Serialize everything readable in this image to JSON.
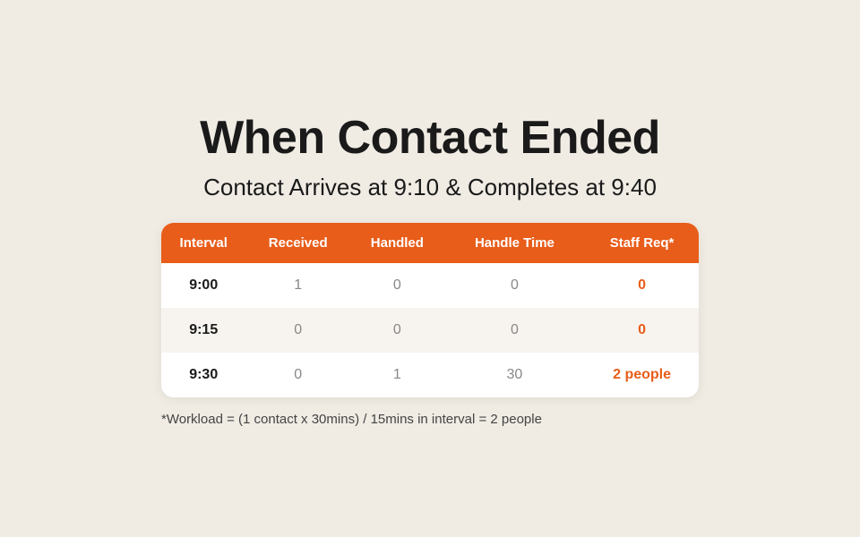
{
  "page": {
    "background_color": "#f0ece4",
    "title": "When Contact Ended",
    "subtitle": "Contact Arrives at 9:10 & Completes at 9:40",
    "footnote": "*Workload = (1 contact x 30mins) / 15mins in interval = 2 people"
  },
  "table": {
    "headers": [
      "Interval",
      "Received",
      "Handled",
      "Handle Time",
      "Staff Req*"
    ],
    "rows": [
      {
        "interval": "9:00",
        "received": "1",
        "handled": "0",
        "handle_time": "0",
        "staff_req": "0",
        "staff_req_highlight": true
      },
      {
        "interval": "9:15",
        "received": "0",
        "handled": "0",
        "handle_time": "0",
        "staff_req": "0",
        "staff_req_highlight": true
      },
      {
        "interval": "9:30",
        "received": "0",
        "handled": "1",
        "handle_time": "30",
        "staff_req": "2 people",
        "staff_req_highlight": true
      }
    ]
  }
}
